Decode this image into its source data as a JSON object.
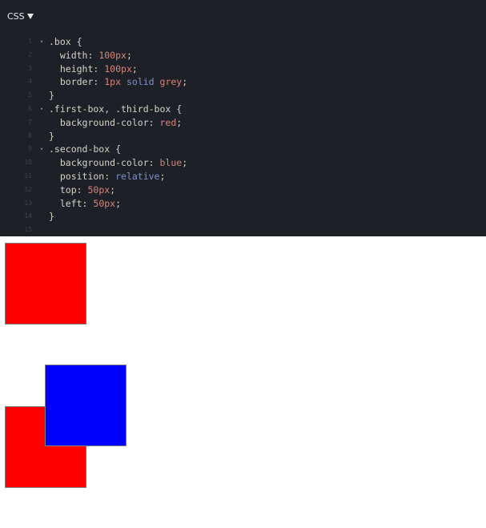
{
  "tab": {
    "label": "CSS"
  },
  "code_lines": [
    {
      "n": "1",
      "parts": [
        {
          "t": ".box {",
          "c": ""
        }
      ]
    },
    {
      "n": "2",
      "parts": [
        {
          "t": "  width: ",
          "c": ""
        },
        {
          "t": "100px",
          "c": "val"
        },
        {
          "t": ";",
          "c": ""
        }
      ]
    },
    {
      "n": "3",
      "parts": [
        {
          "t": "  height: ",
          "c": ""
        },
        {
          "t": "100px",
          "c": "val"
        },
        {
          "t": ";",
          "c": ""
        }
      ]
    },
    {
      "n": "4",
      "parts": [
        {
          "t": "  border: ",
          "c": ""
        },
        {
          "t": "1px",
          "c": "val"
        },
        {
          "t": " ",
          "c": ""
        },
        {
          "t": "solid",
          "c": "kw"
        },
        {
          "t": " ",
          "c": ""
        },
        {
          "t": "grey",
          "c": "val"
        },
        {
          "t": ";",
          "c": ""
        }
      ]
    },
    {
      "n": "5",
      "parts": [
        {
          "t": "}",
          "c": ""
        }
      ]
    },
    {
      "n": "6",
      "parts": [
        {
          "t": ".first-box, .third-box {",
          "c": ""
        }
      ]
    },
    {
      "n": "7",
      "parts": [
        {
          "t": "  background-color: ",
          "c": ""
        },
        {
          "t": "red",
          "c": "val"
        },
        {
          "t": ";",
          "c": ""
        }
      ]
    },
    {
      "n": "8",
      "parts": [
        {
          "t": "}",
          "c": ""
        }
      ]
    },
    {
      "n": "9",
      "parts": [
        {
          "t": ".second-box {",
          "c": ""
        }
      ]
    },
    {
      "n": "10",
      "parts": [
        {
          "t": "  background-color: ",
          "c": ""
        },
        {
          "t": "blue",
          "c": "val"
        },
        {
          "t": ";",
          "c": ""
        }
      ]
    },
    {
      "n": "11",
      "parts": [
        {
          "t": "  position: ",
          "c": ""
        },
        {
          "t": "relative",
          "c": "kw"
        },
        {
          "t": ";",
          "c": ""
        }
      ]
    },
    {
      "n": "12",
      "parts": [
        {
          "t": "  top: ",
          "c": ""
        },
        {
          "t": "50px",
          "c": "val"
        },
        {
          "t": ";",
          "c": ""
        }
      ]
    },
    {
      "n": "13",
      "parts": [
        {
          "t": "  left: ",
          "c": ""
        },
        {
          "t": "50px",
          "c": "val"
        },
        {
          "t": ";",
          "c": ""
        }
      ]
    },
    {
      "n": "14",
      "parts": [
        {
          "t": "}",
          "c": ""
        }
      ]
    },
    {
      "n": "15",
      "parts": []
    }
  ],
  "fold_lines": [
    "1",
    "6",
    "9"
  ],
  "fold_glyph": "▾",
  "colors": {
    "editor_bg": "#1d2027",
    "red_box": "#ff0000",
    "blue_box": "#0000ff",
    "box_border": "#808080"
  },
  "icons": {
    "tab_caret": "caret-down-icon",
    "fold": "fold-arrow-icon"
  }
}
